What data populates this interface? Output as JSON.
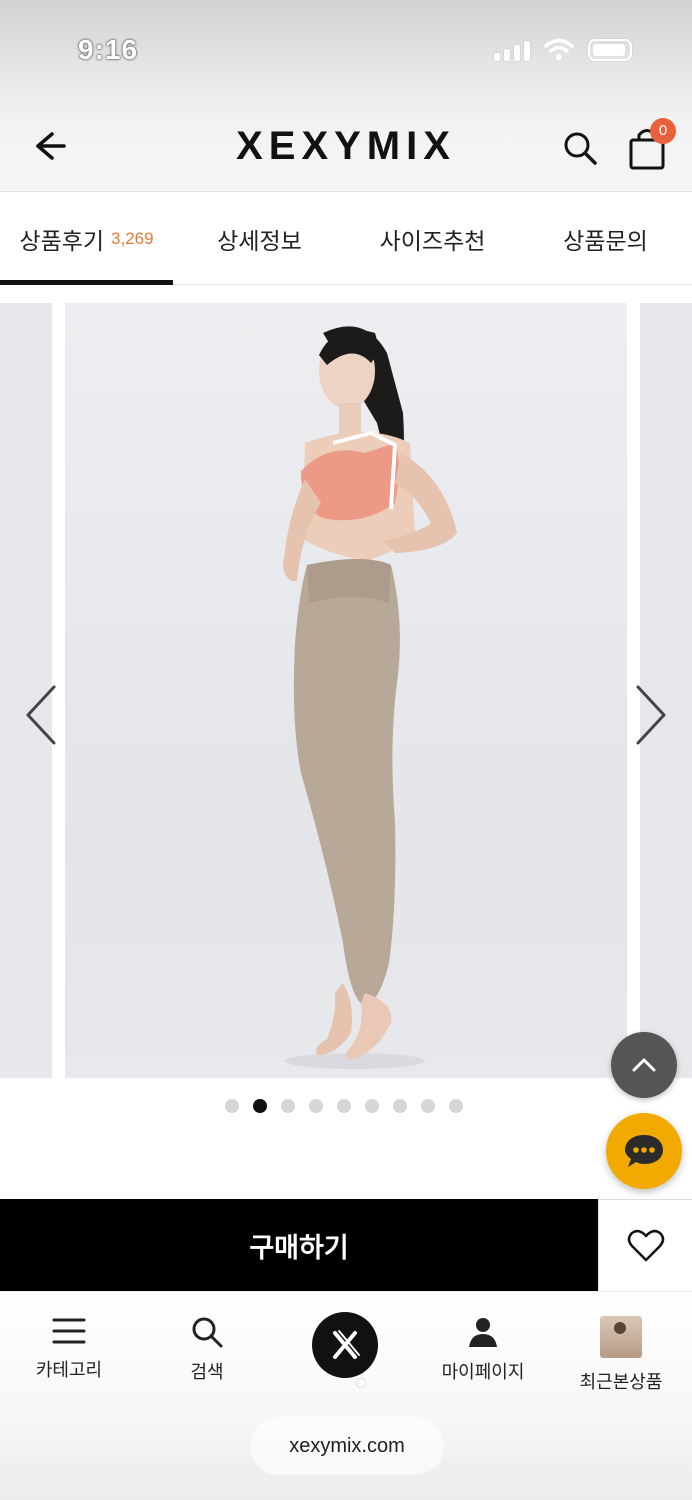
{
  "status": {
    "time": "9:16"
  },
  "header": {
    "brand": "XEXYMIX",
    "cart_count": "0"
  },
  "tabs": [
    {
      "label": "상품후기",
      "count": "3,269",
      "active": true
    },
    {
      "label": "상세정보",
      "active": false
    },
    {
      "label": "사이즈추천",
      "active": false
    },
    {
      "label": "상품문의",
      "active": false
    }
  ],
  "carousel": {
    "slide_count": 9,
    "active_index": 1,
    "image_alt": "model wearing beige leggings and coral sports bra"
  },
  "buy": {
    "label": "구매하기"
  },
  "bottom_nav": [
    {
      "label": "카테고리",
      "icon": "menu-icon"
    },
    {
      "label": "검색",
      "icon": "search-icon"
    },
    {
      "label": "",
      "icon": "xexymix-home-icon"
    },
    {
      "label": "마이페이지",
      "icon": "person-icon"
    },
    {
      "label": "최근본상품",
      "icon": "recent-thumbnail"
    }
  ],
  "browser": {
    "url": "xexymix.com"
  },
  "colors": {
    "accent": "#e8793d",
    "badge": "#e8613a",
    "chat": "#f2a900",
    "buy_bg": "#000000"
  }
}
